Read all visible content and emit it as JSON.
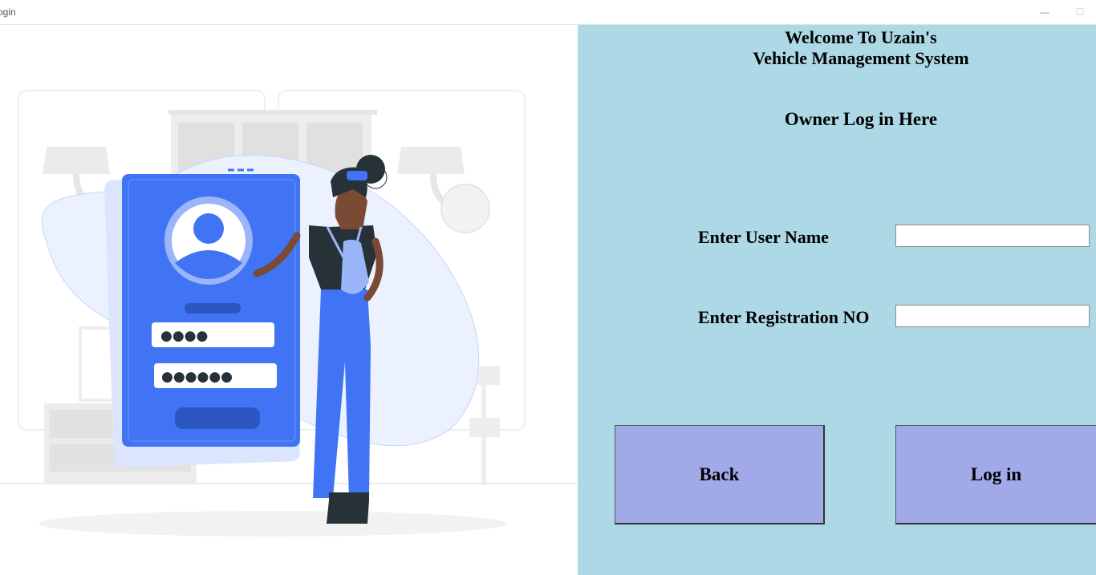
{
  "window": {
    "title": "ogin",
    "minimize_glyph": "—",
    "maximize_glyph": "☐"
  },
  "illustration": {
    "pin_dots": "●●●●",
    "password_dots": "●●●●●●"
  },
  "form": {
    "heading_line1": "Welcome To Uzain's",
    "heading_line2": "Vehicle Management System",
    "subheading": "Owner Log in Here",
    "username_label": "Enter User Name",
    "username_value": "",
    "registration_label": "Enter Registration NO",
    "registration_value": "",
    "back_label": "Back",
    "login_label": "Log in"
  },
  "colors": {
    "panel_bg": "#add8e6",
    "button_bg": "#a1a9e8",
    "accent_blue": "#4074f4"
  }
}
